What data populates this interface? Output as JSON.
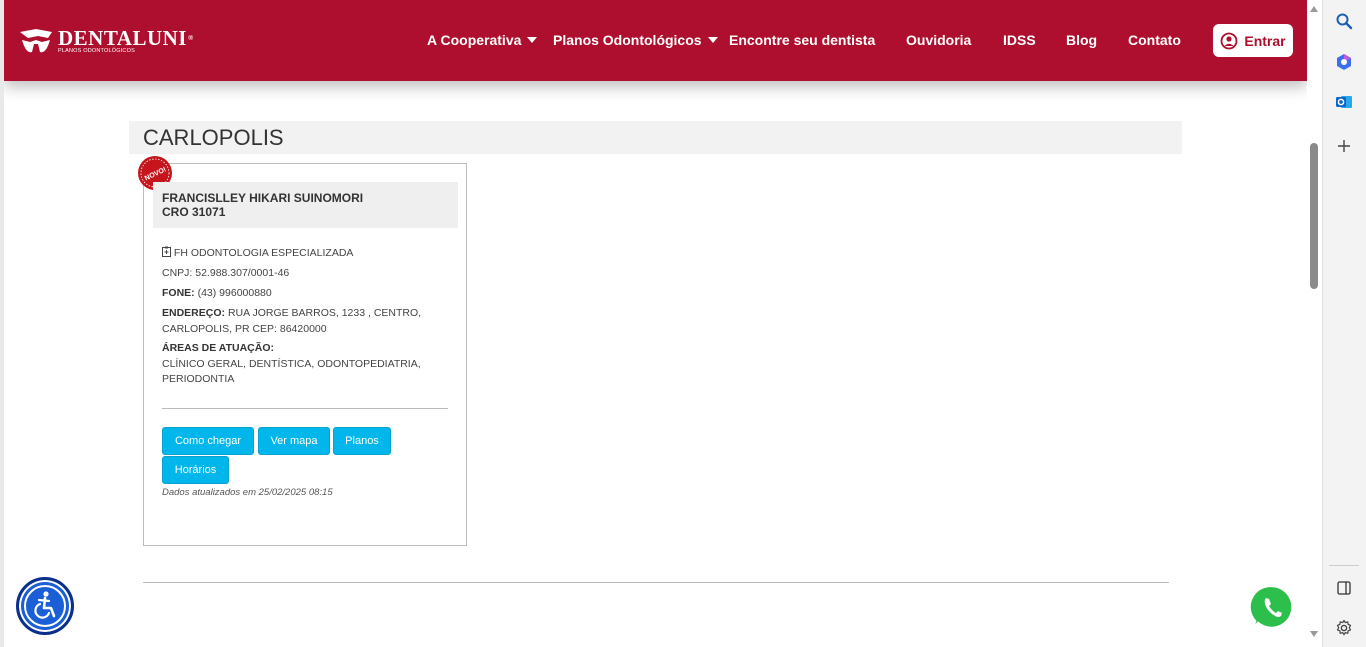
{
  "header": {
    "brand": "DENTALUNI",
    "brand_reg": "®",
    "brand_sub": "PLANOS ODONTOLÓGICOS",
    "nav": [
      {
        "label": "A Cooperativa",
        "dropdown": true
      },
      {
        "label": "Planos Odontológicos",
        "dropdown": true
      },
      {
        "label": "Encontre seu dentista",
        "dropdown": false
      },
      {
        "label": "Ouvidoria",
        "dropdown": false
      },
      {
        "label": "IDSS",
        "dropdown": false
      },
      {
        "label": "Blog",
        "dropdown": false
      },
      {
        "label": "Contato",
        "dropdown": false
      }
    ],
    "login_label": "Entrar",
    "colors": {
      "brand": "#ae0f2e"
    }
  },
  "city": {
    "title": "CARLOPOLIS"
  },
  "dentist": {
    "badge": "NOVO!",
    "name": "FRANCISLLEY HIKARI SUINOMORI",
    "cro": "CRO 31071",
    "clinic": "FH ODONTOLOGIA ESPECIALIZADA",
    "cnpj": "CNPJ: 52.988.307/0001-46",
    "phone_label": "FONE:",
    "phone": "(43) 996000880",
    "address_label": "ENDEREÇO:",
    "address": "RUA JORGE BARROS, 1233 , CENTRO, CARLOPOLIS, PR CEP: 86420000",
    "areas_label": "ÁREAS DE ATUAÇÃO:",
    "areas": "CLÍNICO GERAL, DENTÍSTICA, ODONTOPEDIATRIA, PERIODONTIA",
    "buttons": [
      "Como chegar",
      "Ver mapa",
      "Planos",
      "Horários"
    ],
    "updated": "Dados atualizados em 25/02/2025 08:15",
    "colors": {
      "button": "#00b6ea"
    }
  },
  "floating": {
    "accessibility_icon": "accessibility-icon",
    "whatsapp_icon": "whatsapp-icon"
  },
  "edge_sidebar": {
    "icons": [
      "search-icon",
      "copilot-icon",
      "outlook-icon",
      "add-icon",
      "sidebar-toggle-icon",
      "settings-icon"
    ]
  }
}
